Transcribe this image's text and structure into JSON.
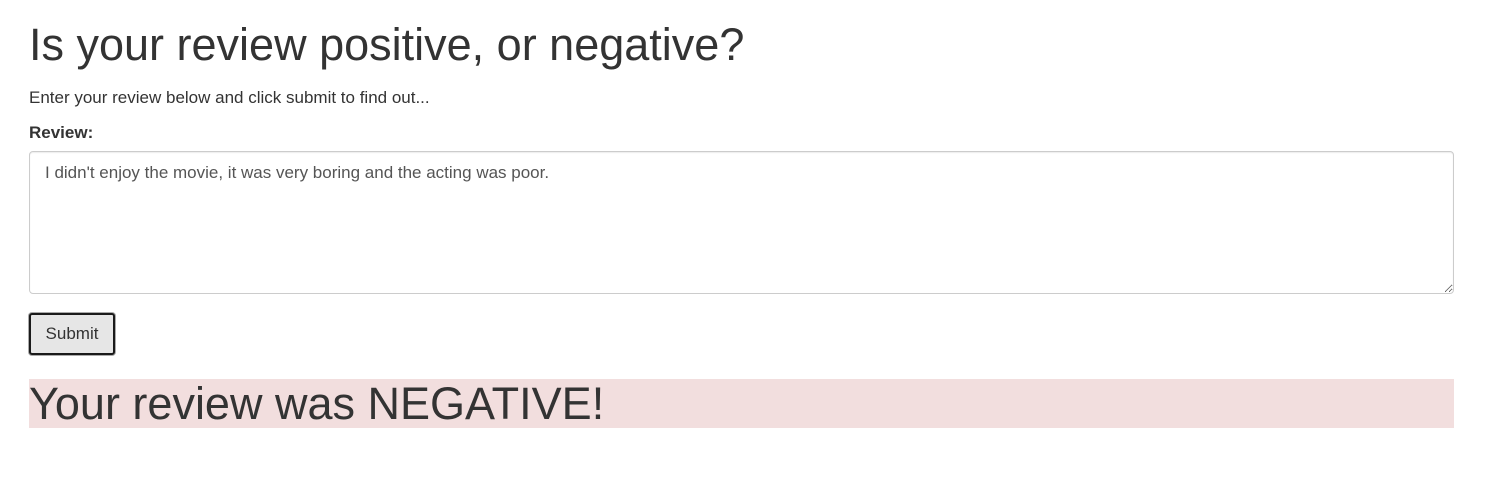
{
  "page": {
    "title": "Is your review positive, or negative?",
    "subtitle": "Enter your review below and click submit to find out..."
  },
  "form": {
    "review_label": "Review:",
    "review_value": "I didn't enjoy the movie, it was very boring and the acting was poor.",
    "submit_label": "Submit"
  },
  "result": {
    "message": "Your review was NEGATIVE!",
    "background_color": "#f2dede"
  }
}
